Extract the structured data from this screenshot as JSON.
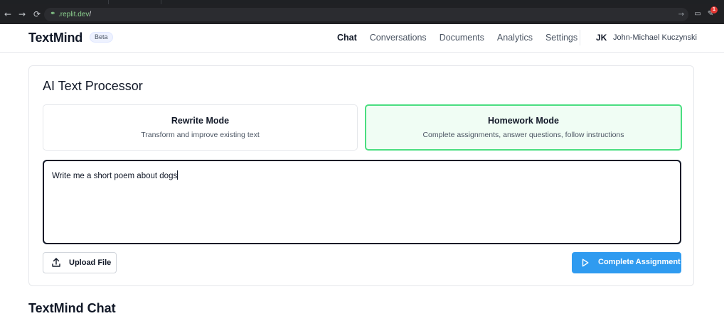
{
  "browser": {
    "url_host": ".replit.dev",
    "url_path": "/",
    "extension_badge": "1"
  },
  "header": {
    "logo": "TextMind",
    "badge": "Beta",
    "nav": [
      {
        "label": "Chat",
        "active": true
      },
      {
        "label": "Conversations",
        "active": false
      },
      {
        "label": "Documents",
        "active": false
      },
      {
        "label": "Analytics",
        "active": false
      },
      {
        "label": "Settings",
        "active": false
      }
    ],
    "user": {
      "initials": "JK",
      "name": "John-Michael Kuczynski"
    }
  },
  "processor": {
    "title": "AI Text Processor",
    "modes": [
      {
        "title": "Rewrite Mode",
        "description": "Transform and improve existing text",
        "selected": false
      },
      {
        "title": "Homework Mode",
        "description": "Complete assignments, answer questions, follow instructions",
        "selected": true
      }
    ],
    "input_value": "Write me a short poem about dogs",
    "upload_label": "Upload File",
    "submit_label": "Complete Assignment"
  },
  "chat_section": {
    "title": "TextMind Chat"
  },
  "colors": {
    "accent_blue": "#2f9bf0",
    "selected_green_border": "#4ade80",
    "selected_green_bg": "#f0fdf4"
  }
}
